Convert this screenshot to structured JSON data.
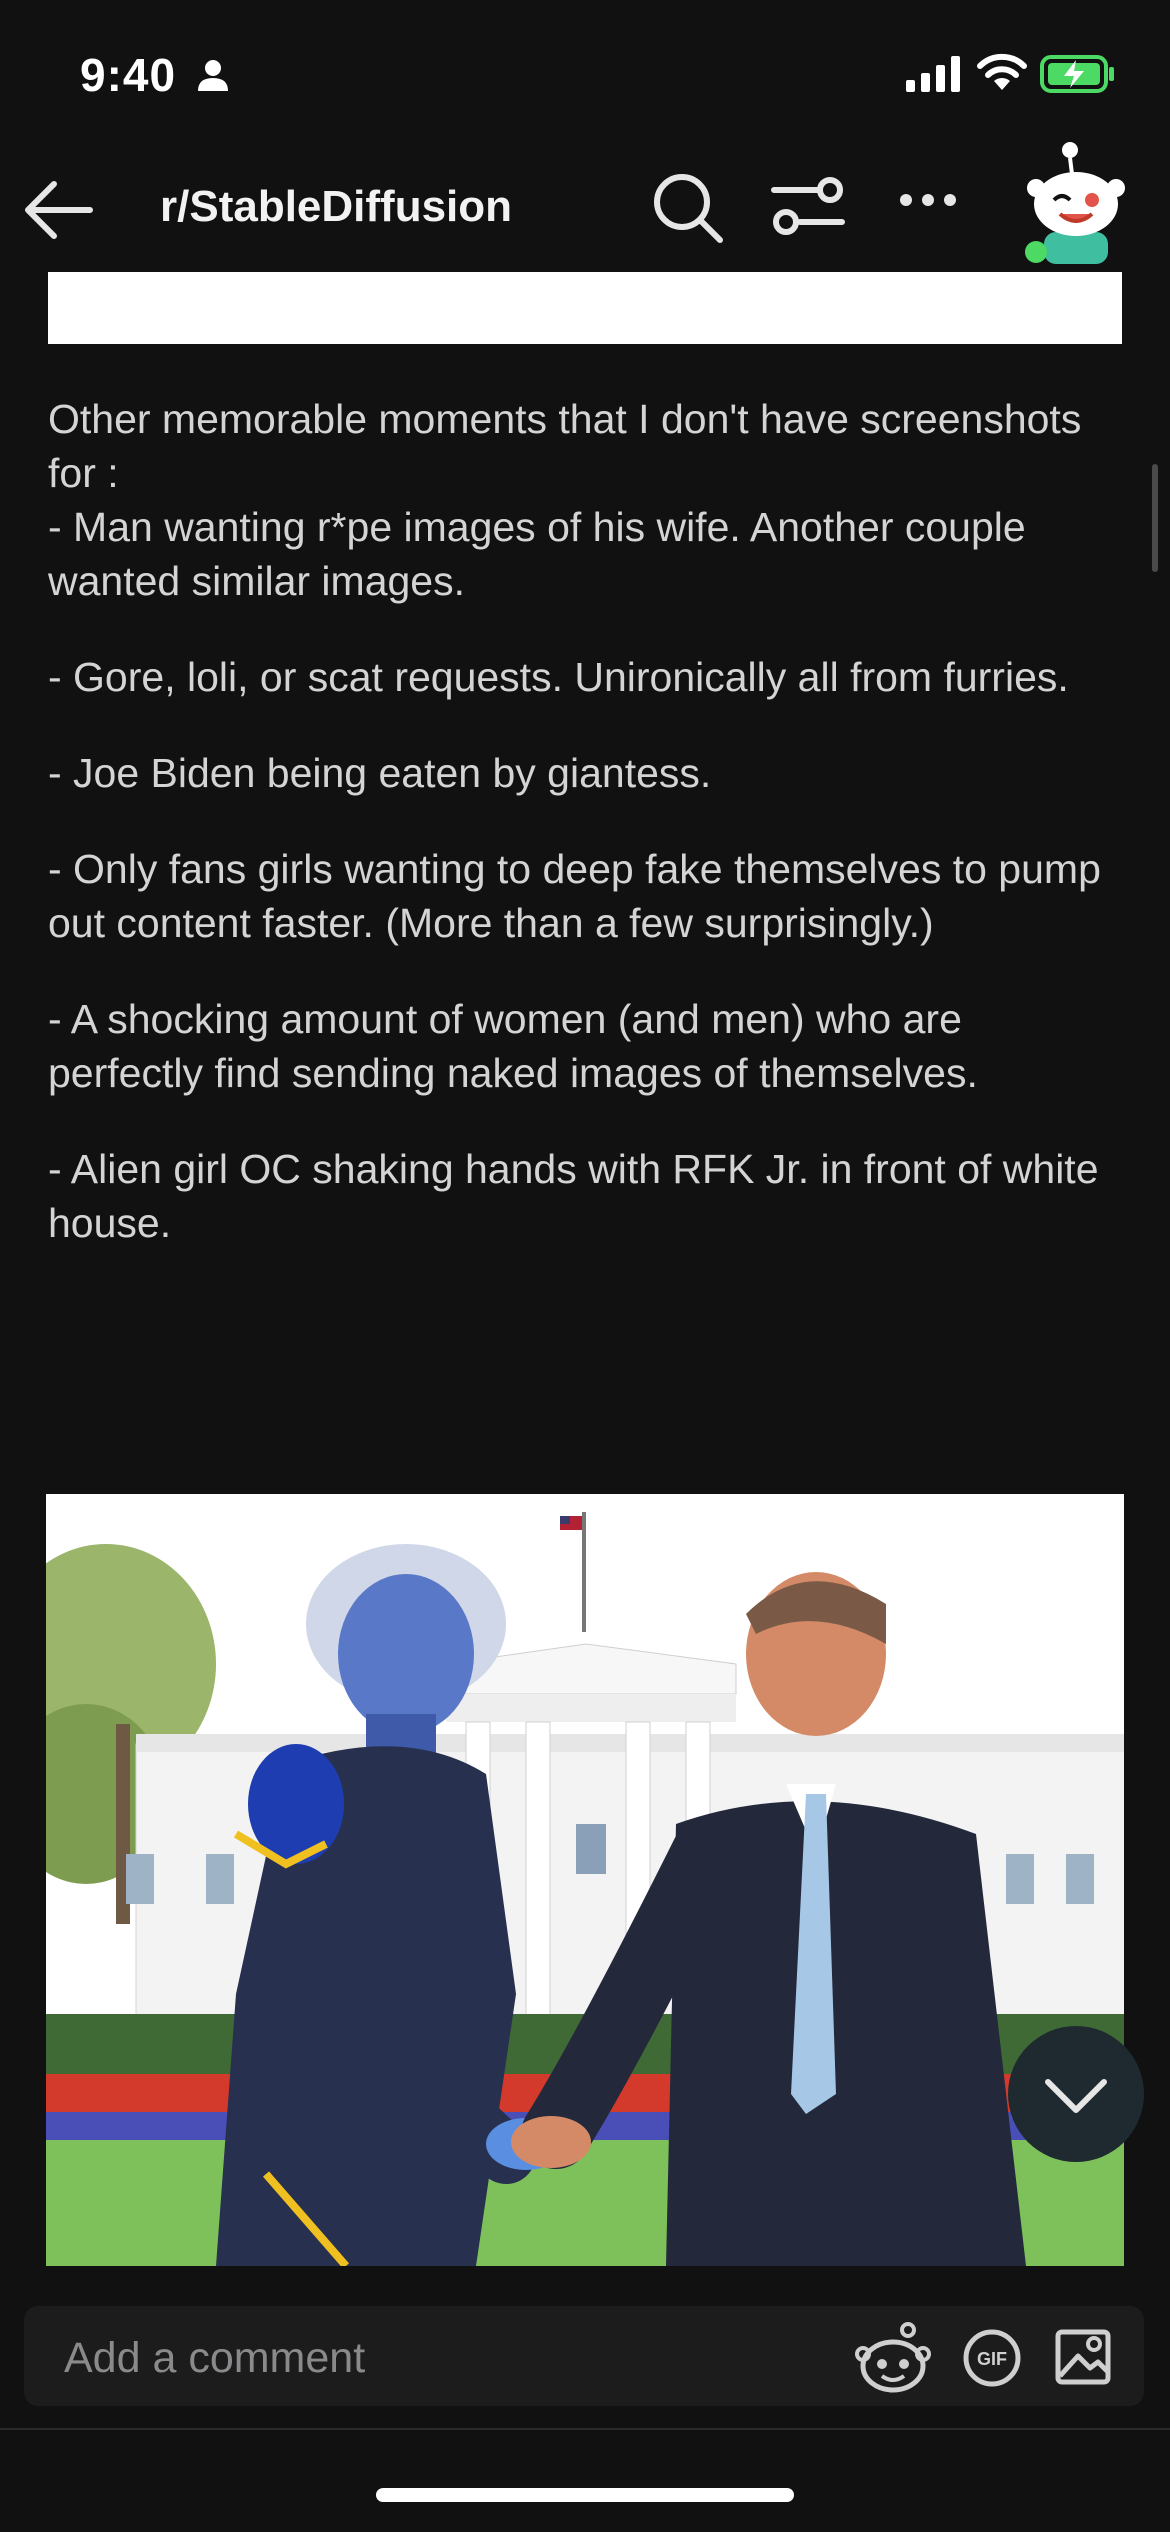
{
  "status": {
    "time": "9:40"
  },
  "header": {
    "title": "r/StableDiffusion"
  },
  "post": {
    "paragraphs": [
      "Other memorable moments that I don't have screenshots for :\n- Man wanting r*pe images of his wife. Another couple wanted similar images.",
      "- Gore, loli, or scat requests. Unironically all from furries.",
      "- Joe Biden being eaten by giantess.",
      "- Only fans girls wanting to deep fake themselves to pump out content faster. (More than a few surprisingly.)",
      "- A shocking amount of women (and men) who are perfectly find sending naked images of themselves.",
      "- Alien girl OC shaking hands with RFK Jr. in front of white house."
    ]
  },
  "comment": {
    "placeholder": "Add a comment"
  },
  "icons": {
    "back": "back-arrow-icon",
    "search": "search-icon",
    "filter": "filter-icon",
    "more": "more-icon",
    "avatar": "snoo-avatar",
    "scroll": "chevron-down-icon",
    "snoo": "snoo-icon",
    "gif": "gif-icon",
    "image": "image-icon"
  },
  "colors": {
    "background": "#111112",
    "text": "#d4d4d4",
    "battery": "#4cd964"
  }
}
